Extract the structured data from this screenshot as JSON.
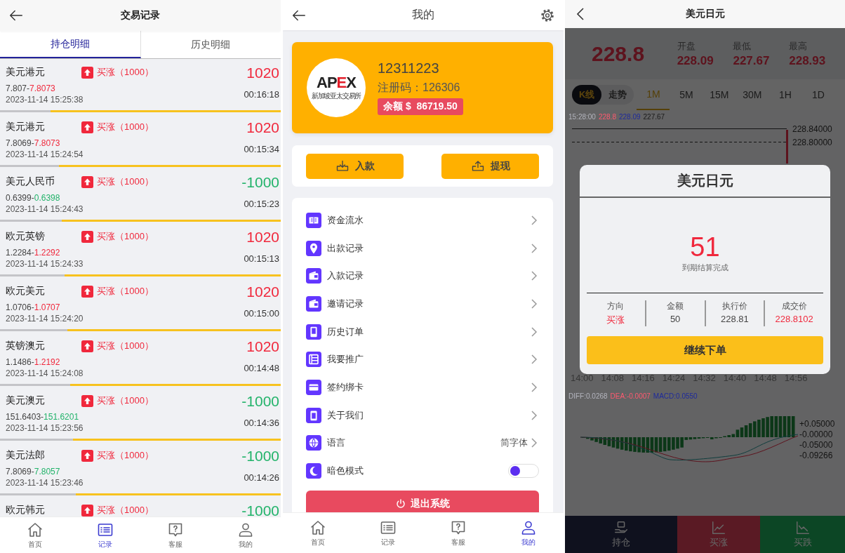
{
  "records_screen": {
    "title": "交易记录",
    "tabs": [
      {
        "label": "持仓明细",
        "selected": true
      },
      {
        "label": "历史明细",
        "selected": false
      }
    ],
    "positions": [
      {
        "pair": "美元港元",
        "side": "买涨（1000）",
        "profit": "1020",
        "kind": "win",
        "open_price": "7.807-",
        "close_price": "7.8073",
        "opened_at": "2023-11-14 15:25:38",
        "countdown": "00:16:18",
        "level": 0.82
      },
      {
        "pair": "美元港元",
        "side": "买涨（1000）",
        "profit": "1020",
        "kind": "win",
        "open_price": "7.8069-",
        "close_price": "7.8073",
        "opened_at": "2023-11-14 15:24:54",
        "countdown": "00:15:34",
        "level": 0.79
      },
      {
        "pair": "美元人民币",
        "side": "买涨（1000）",
        "profit": "-1000",
        "kind": "loss",
        "open_price": "0.6399-",
        "close_price": "0.6398",
        "opened_at": "2023-11-14 15:24:43",
        "countdown": "00:15:23",
        "level": 0.78
      },
      {
        "pair": "欧元英镑",
        "side": "买涨（1000）",
        "profit": "1020",
        "kind": "win",
        "open_price": "1.2284-",
        "close_price": "1.2292",
        "opened_at": "2023-11-14 15:24:33",
        "countdown": "00:15:13",
        "level": 0.77
      },
      {
        "pair": "欧元美元",
        "side": "买涨（1000）",
        "profit": "1020",
        "kind": "win",
        "open_price": "1.0706-",
        "close_price": "1.0707",
        "opened_at": "2023-11-14 15:24:20",
        "countdown": "00:15:00",
        "level": 0.76
      },
      {
        "pair": "英镑澳元",
        "side": "买涨（1000）",
        "profit": "1020",
        "kind": "win",
        "open_price": "1.1486-",
        "close_price": "1.2192",
        "opened_at": "2023-11-14 15:24:08",
        "countdown": "00:14:48",
        "level": 0.75
      },
      {
        "pair": "美元澳元",
        "side": "买涨（1000）",
        "profit": "-1000",
        "kind": "loss",
        "open_price": "151.6403-",
        "close_price": "151.6201",
        "opened_at": "2023-11-14 15:23:56",
        "countdown": "00:14:36",
        "level": 0.74
      },
      {
        "pair": "美元法郎",
        "side": "买涨（1000）",
        "profit": "-1000",
        "kind": "loss",
        "open_price": "7.8069-",
        "close_price": "7.8057",
        "opened_at": "2023-11-14 15:23:46",
        "countdown": "00:14:26",
        "level": 0.73
      },
      {
        "pair": "欧元韩元",
        "side": "买涨（1000）",
        "profit": "-1000",
        "kind": "loss"
      }
    ],
    "nav": [
      {
        "label": "首页",
        "selected": false
      },
      {
        "label": "记录",
        "selected": true
      },
      {
        "label": "客服",
        "selected": false
      },
      {
        "label": "我的",
        "selected": false
      }
    ]
  },
  "profile_screen": {
    "title": "我的",
    "logo": {
      "wordmark_start": "AP",
      "wordmark_accent": "E",
      "wordmark_end": "X",
      "subtitle": "新加坡亚太交易所"
    },
    "account": {
      "user_id": "12311223",
      "register_code": "注册码：126306",
      "balance": "余额 $  86719.50"
    },
    "actions": [
      {
        "label": "入款",
        "kind": "deposit"
      },
      {
        "label": "提现",
        "kind": "withdraw"
      }
    ],
    "menu": [
      {
        "label": "资金流水",
        "kind": "link"
      },
      {
        "label": "出款记录",
        "kind": "link"
      },
      {
        "label": "入款记录",
        "kind": "link"
      },
      {
        "label": "邀请记录",
        "kind": "link"
      },
      {
        "label": "历史订单",
        "kind": "link"
      },
      {
        "label": "我要推广",
        "kind": "link"
      },
      {
        "label": "签约绑卡",
        "kind": "link"
      },
      {
        "label": "关于我们",
        "kind": "link"
      },
      {
        "label": "语言",
        "kind": "value",
        "value": "简字体"
      },
      {
        "label": "暗色模式",
        "kind": "toggle",
        "on": false
      }
    ],
    "logout": "退出系统",
    "nav": [
      {
        "label": "首页",
        "selected": false
      },
      {
        "label": "记录",
        "selected": false
      },
      {
        "label": "客服",
        "selected": false
      },
      {
        "label": "我的",
        "selected": true
      }
    ]
  },
  "quote_screen": {
    "title": "美元日元",
    "price": "228.8",
    "stats": [
      {
        "label": "开盘",
        "value": "228.09"
      },
      {
        "label": "最低",
        "value": "227.67"
      },
      {
        "label": "最高",
        "value": "228.93"
      }
    ],
    "chart_modes": [
      {
        "label": "K线",
        "selected": true
      },
      {
        "label": "走势",
        "selected": false
      }
    ],
    "periods": [
      {
        "label": "1M",
        "selected": true
      },
      {
        "label": "5M",
        "selected": false
      },
      {
        "label": "15M",
        "selected": false
      },
      {
        "label": "30M",
        "selected": false
      },
      {
        "label": "1H",
        "selected": false
      },
      {
        "label": "1D",
        "selected": false
      }
    ],
    "legend": [
      {
        "text": "15:28:00",
        "color": "#b4b5be"
      },
      {
        "text": "228.8",
        "color": "#ff5a70"
      },
      {
        "text": "228.09",
        "color": "#1e2a9c"
      },
      {
        "text": "227.67",
        "color": "#1a1a1a"
      }
    ],
    "price_axis": [
      "228.84000",
      "228.80000"
    ],
    "time_axis": [
      "14:00",
      "14:08",
      "14:16",
      "14:24",
      "14:32",
      "14:40",
      "14:48",
      "14:56"
    ],
    "macd_legend": [
      {
        "text": "DIFF:0.0268",
        "color": "#b4b5be"
      },
      {
        "text": "DEA:-0.0007",
        "color": "#ff5a70"
      },
      {
        "text": "MACD:0.0550",
        "color": "#1e2a9c"
      }
    ],
    "macd_axis": [
      "+0.05000",
      "-0.00000",
      "-0.05000",
      "-0.09266"
    ],
    "actions": [
      {
        "label": "持仓",
        "kind": "positions"
      },
      {
        "label": "买涨",
        "kind": "buy_up"
      },
      {
        "label": "买跌",
        "kind": "buy_down"
      }
    ],
    "result_dialog": {
      "title": "美元日元",
      "amount": "51",
      "message": "到期结算完成",
      "details": [
        {
          "label": "方向",
          "value": "买涨",
          "highlight": true
        },
        {
          "label": "金额",
          "value": "50",
          "highlight": false
        },
        {
          "label": "执行价",
          "value": "228.81",
          "highlight": false
        },
        {
          "label": "成交价",
          "value": "228.8102",
          "highlight": true
        }
      ],
      "button": "继续下单"
    }
  }
}
